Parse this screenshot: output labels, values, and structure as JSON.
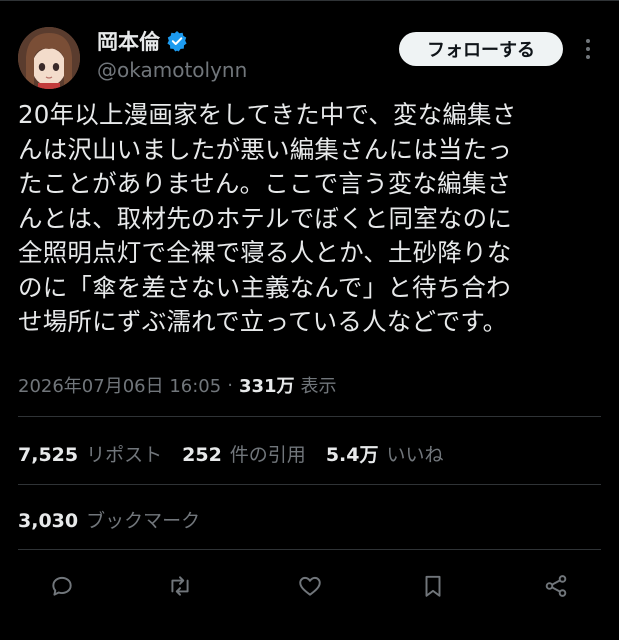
{
  "user": {
    "display_name": "岡本倫",
    "handle": "@okamotolynn",
    "verified": true,
    "verified_color": "#1d9bf0"
  },
  "follow_button": {
    "label": "フォローする"
  },
  "tweet": {
    "lines": [
      "20年以上漫画家をしてきた中で、変な編集さ",
      "んは沢山いましたが悪い編集さんには当たっ",
      "たことがありません。ここで言う変な編集さ",
      "んとは、取材先のホテルでぼくと同室なのに",
      "全照明点灯で全裸で寝る人とか、土砂降りな",
      "のに「傘を差さない主義なんで」と待ち合わ",
      "せ場所にずぶ濡れで立っている人などです。"
    ],
    "timestamp": "2026年07月06日 16:05",
    "separator": "·",
    "views": "331万",
    "views_label": "表示"
  },
  "stats": {
    "reposts": {
      "value": "7,525",
      "label": "リポスト"
    },
    "quotes": {
      "value": "252",
      "label": "件の引用"
    },
    "likes": {
      "value": "5.4万",
      "label": "いいね"
    },
    "bookmarks": {
      "value": "3,030",
      "label": "ブックマーク"
    }
  },
  "actions": [
    {
      "icon": "reply-icon"
    },
    {
      "icon": "repost-icon"
    },
    {
      "icon": "like-icon"
    },
    {
      "icon": "bookmark-icon"
    },
    {
      "icon": "share-icon"
    }
  ],
  "colors": {
    "background": "#000000",
    "text": "#e7e9ea",
    "secondary": "#71767b",
    "divider": "#2f3336"
  }
}
